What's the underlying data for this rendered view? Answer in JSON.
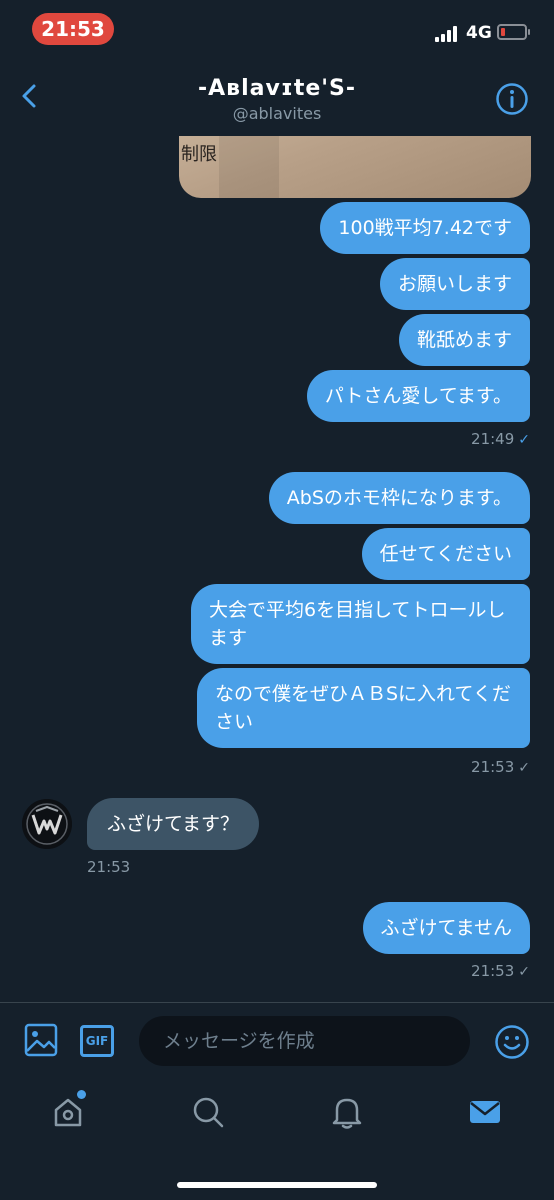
{
  "status": {
    "time": "21:53",
    "network": "4G"
  },
  "header": {
    "title": "-Aʙlavɪte'S-",
    "handle": "@ablavites"
  },
  "image_message": {
    "visible_text": "制限"
  },
  "messages_out_1": [
    "100戦平均7.42です",
    "お願いします",
    "靴舐めます",
    "パトさん愛してます。"
  ],
  "timestamp_1": "21:49",
  "messages_out_2": [
    "AbSのホモ枠になります。",
    "任せてください",
    "大会で平均6を目指してトロールします",
    "なので僕をぜひＡＢSに入れてください"
  ],
  "timestamp_2": "21:53",
  "incoming": {
    "text": "ふざけてます？",
    "time": "21:53"
  },
  "messages_out_3": [
    "ふざけてません"
  ],
  "timestamp_3": "21:53",
  "compose": {
    "placeholder": "メッセージを作成",
    "gif_label": "GIF"
  },
  "colors": {
    "accent": "#4aa0e8",
    "background": "#15202b",
    "incoming_bubble": "#3d5466"
  },
  "tabs": [
    "home-icon",
    "search-icon",
    "notifications-icon",
    "messages-icon"
  ]
}
